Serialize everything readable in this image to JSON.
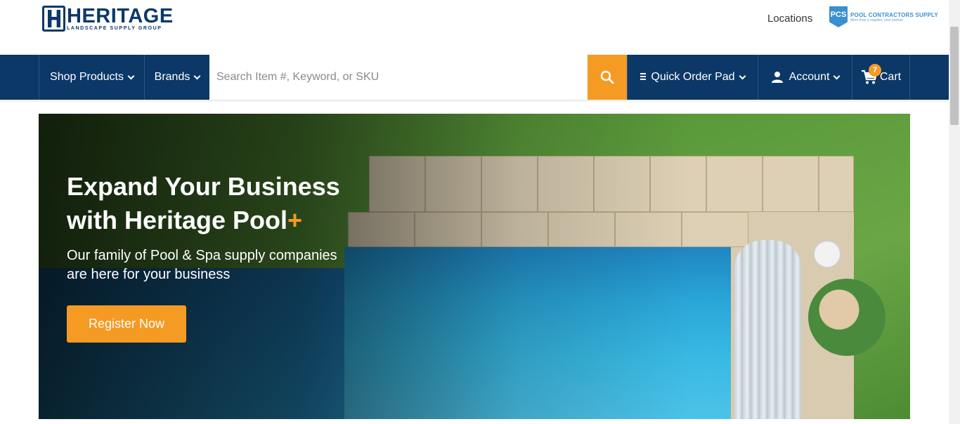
{
  "brand": {
    "logo_title": "HERITAGE",
    "logo_subtitle": "LANDSCAPE SUPPLY GROUP",
    "color_primary": "#0c3868",
    "color_accent": "#f59a23"
  },
  "header": {
    "locations_label": "Locations",
    "partner_badge": "PCS",
    "partner_name": "POOL CONTRACTORS SUPPLY",
    "partner_tagline": "More than a supplier, your partner"
  },
  "nav": {
    "shop_products": "Shop Products",
    "brands": "Brands",
    "search_placeholder": "Search Item #, Keyword, or SKU",
    "quick_order_pad": "Quick Order Pad",
    "account": "Account",
    "cart": "Cart",
    "cart_count": "7"
  },
  "hero": {
    "title_line1": "Expand Your Business",
    "title_line2": "with Heritage Pool",
    "title_plus": "+",
    "subtitle": "Our family of Pool & Spa supply companies  are here for your business",
    "cta": "Register Now"
  }
}
